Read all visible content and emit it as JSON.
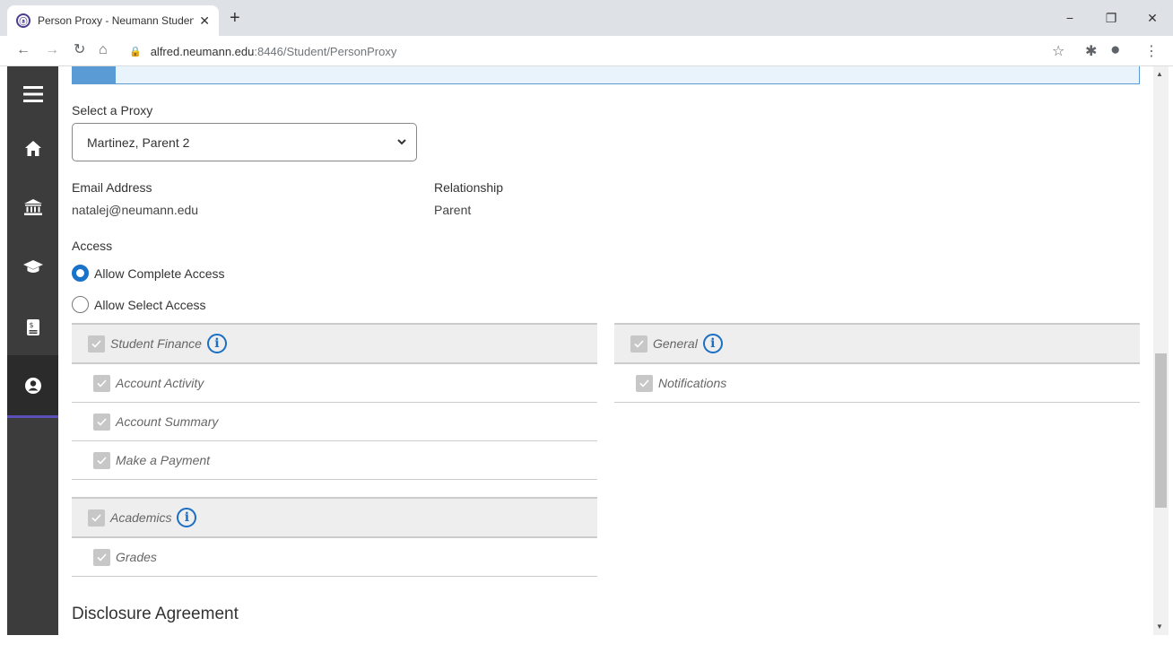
{
  "browser": {
    "tab_title": "Person Proxy - Neumann Studen",
    "tab_favicon": "ⓐ",
    "url_host": "alfred.neumann.edu",
    "url_rest": ":8446/Student/PersonProxy"
  },
  "nav": {
    "items": [
      {
        "name": "menu-icon"
      },
      {
        "name": "home-icon"
      },
      {
        "name": "bank-icon"
      },
      {
        "name": "graduation-cap-icon"
      },
      {
        "name": "finance-icon"
      },
      {
        "name": "person-proxy-icon",
        "active": true
      }
    ]
  },
  "form": {
    "proxy_label": "Select a Proxy",
    "proxy_value": "Martinez, Parent 2",
    "email_label": "Email Address",
    "email_value": "natalej@neumann.edu",
    "relationship_label": "Relationship",
    "relationship_value": "Parent",
    "access_label": "Access",
    "option_complete": "Allow Complete Access",
    "option_select": "Allow Select Access",
    "selected_option": "complete"
  },
  "permissions": {
    "student_finance": {
      "title": "Student Finance",
      "items": [
        "Account Activity",
        "Account Summary",
        "Make a Payment"
      ]
    },
    "general": {
      "title": "General",
      "items": [
        "Notifications"
      ]
    },
    "academics": {
      "title": "Academics",
      "items": [
        "Grades"
      ]
    }
  },
  "disclosure_title": "Disclosure Agreement",
  "colors": {
    "accent": "#1a73c8",
    "nav_bg": "#3c3c3c",
    "active_underline": "#5b4fb8"
  }
}
